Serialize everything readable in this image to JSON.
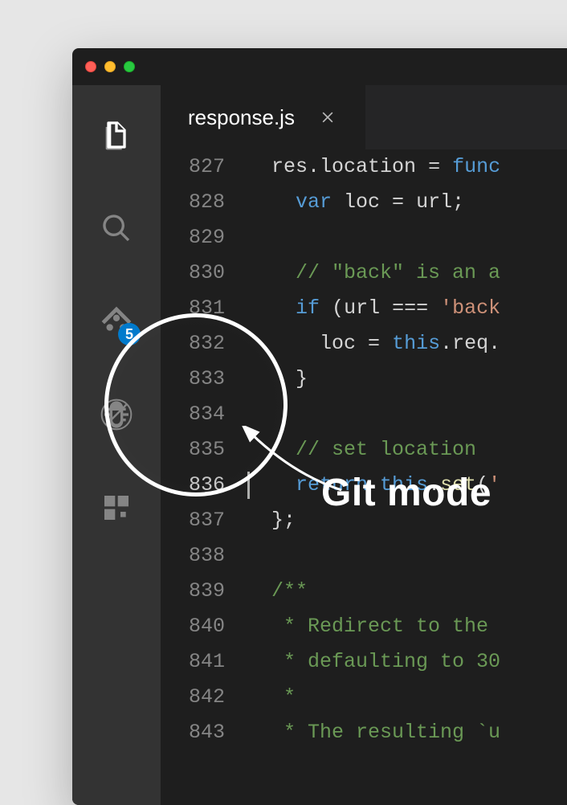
{
  "traffic": {
    "buttons": [
      "close",
      "minimize",
      "zoom"
    ]
  },
  "activitybar": {
    "items": [
      {
        "name": "explorer",
        "active": true
      },
      {
        "name": "search"
      },
      {
        "name": "git",
        "badge": "5"
      },
      {
        "name": "debug"
      },
      {
        "name": "extensions"
      }
    ]
  },
  "tabs": [
    {
      "label": "response.js",
      "active": true
    }
  ],
  "editor": {
    "highlight_line": 836,
    "lines": [
      {
        "n": 827,
        "tokens": [
          [
            "id",
            "  res"
          ],
          [
            "op",
            "."
          ],
          [
            "id",
            "location"
          ],
          [
            "op",
            " = "
          ],
          [
            "kw",
            "func"
          ]
        ]
      },
      {
        "n": 828,
        "tokens": [
          [
            "id",
            "    "
          ],
          [
            "kw",
            "var"
          ],
          [
            "id",
            " loc "
          ],
          [
            "op",
            "="
          ],
          [
            "id",
            " url"
          ],
          [
            "op",
            ";"
          ]
        ]
      },
      {
        "n": 829,
        "tokens": [
          [
            "id",
            ""
          ]
        ]
      },
      {
        "n": 830,
        "tokens": [
          [
            "id",
            "    "
          ],
          [
            "cm",
            "// \"back\" is an a"
          ]
        ]
      },
      {
        "n": 831,
        "tokens": [
          [
            "id",
            "    "
          ],
          [
            "kw",
            "if"
          ],
          [
            "id",
            " "
          ],
          [
            "op",
            "("
          ],
          [
            "id",
            "url "
          ],
          [
            "op",
            "==="
          ],
          [
            "id",
            " "
          ],
          [
            "str",
            "'back"
          ]
        ]
      },
      {
        "n": 832,
        "tokens": [
          [
            "id",
            "      loc "
          ],
          [
            "op",
            "="
          ],
          [
            "id",
            " "
          ],
          [
            "kw",
            "this"
          ],
          [
            "op",
            "."
          ],
          [
            "id",
            "req"
          ],
          [
            "op",
            "."
          ]
        ]
      },
      {
        "n": 833,
        "tokens": [
          [
            "id",
            "    "
          ],
          [
            "op",
            "}"
          ]
        ]
      },
      {
        "n": 834,
        "tokens": [
          [
            "id",
            ""
          ]
        ]
      },
      {
        "n": 835,
        "tokens": [
          [
            "id",
            "    "
          ],
          [
            "cm",
            "// set location"
          ]
        ]
      },
      {
        "n": 836,
        "tokens": [
          [
            "id",
            "    "
          ],
          [
            "kw",
            "return"
          ],
          [
            "id",
            " "
          ],
          [
            "kw",
            "this"
          ],
          [
            "op",
            "."
          ],
          [
            "fn",
            "set"
          ],
          [
            "op",
            "("
          ],
          [
            "str",
            "'"
          ]
        ]
      },
      {
        "n": 837,
        "tokens": [
          [
            "id",
            "  "
          ],
          [
            "op",
            "};"
          ]
        ]
      },
      {
        "n": 838,
        "tokens": [
          [
            "id",
            ""
          ]
        ]
      },
      {
        "n": 839,
        "tokens": [
          [
            "id",
            "  "
          ],
          [
            "cm",
            "/**"
          ]
        ]
      },
      {
        "n": 840,
        "tokens": [
          [
            "id",
            "   "
          ],
          [
            "cm",
            "* Redirect to the "
          ]
        ]
      },
      {
        "n": 841,
        "tokens": [
          [
            "id",
            "   "
          ],
          [
            "cm",
            "* defaulting to 30"
          ]
        ]
      },
      {
        "n": 842,
        "tokens": [
          [
            "id",
            "   "
          ],
          [
            "cm",
            "*"
          ]
        ]
      },
      {
        "n": 843,
        "tokens": [
          [
            "id",
            "   "
          ],
          [
            "cm",
            "* The resulting `u"
          ]
        ]
      }
    ]
  },
  "annotation": {
    "label": "Git mode"
  }
}
